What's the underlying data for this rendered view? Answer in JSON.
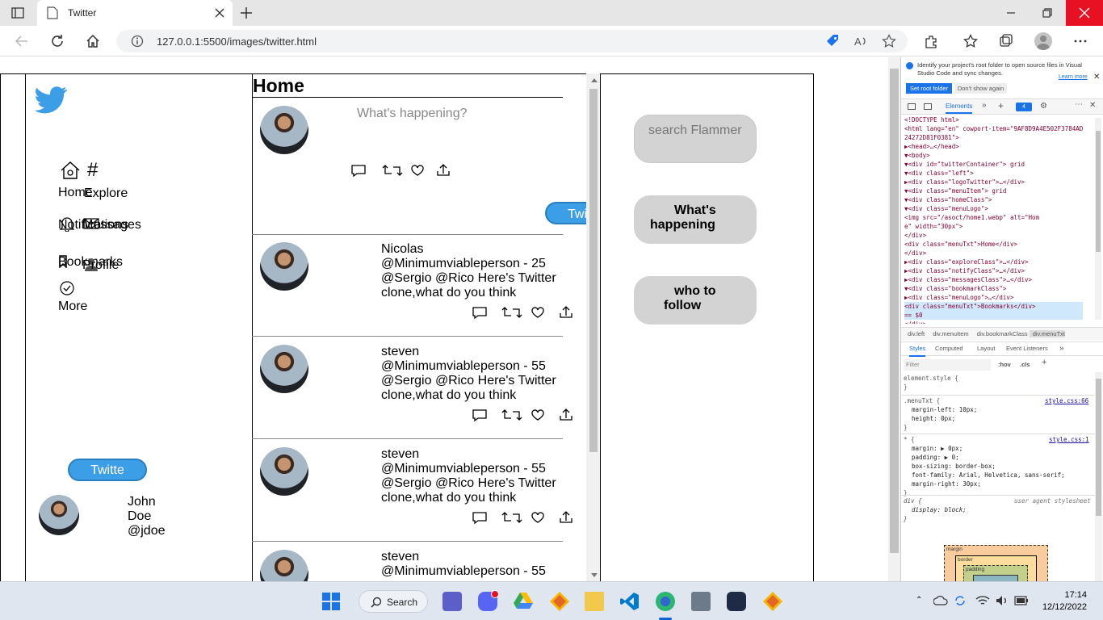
{
  "browser": {
    "tab_title": "Twitter",
    "url": "127.0.0.1:5500/images/twitter.html"
  },
  "sidebar": {
    "items": [
      {
        "label": "Home",
        "icon": "home-icon"
      },
      {
        "label": "Explore",
        "icon": "hashtag-icon"
      },
      {
        "label": "Notifications",
        "icon": "bell-icon"
      },
      {
        "label": "Messages",
        "icon": "mail-icon"
      },
      {
        "label": "Bookmarks",
        "icon": "bookmark-icon"
      },
      {
        "label": "Profile",
        "icon": "person-icon"
      },
      {
        "label": "More",
        "icon": "more-circle-icon"
      }
    ],
    "tweet_button": "Twitte",
    "user": {
      "name_line1": "John",
      "name_line2": "Doe",
      "handle": "@jdoe"
    }
  },
  "feed": {
    "title": "Home",
    "compose_placeholder": "What's happening?",
    "tweet_button": "Twi",
    "tweets": [
      {
        "name": "Nicolas",
        "line1": "@Minimumviableperson - 25",
        "line2": "@Sergio @Rico Here's Twitter",
        "line3": "clone,what do you think"
      },
      {
        "name": "steven",
        "line1": "@Minimumviableperson - 55",
        "line2": "@Sergio @Rico Here's Twitter",
        "line3": "clone,what do you think"
      },
      {
        "name": "steven",
        "line1": "@Minimumviableperson - 55",
        "line2": "@Sergio @Rico Here's Twitter",
        "line3": "clone,what do you think"
      },
      {
        "name": "steven",
        "line1": "@Minimumviableperson - 55",
        "line2": "",
        "line3": ""
      }
    ]
  },
  "right": {
    "search_placeholder": "search Flammer",
    "whats_happening_1": "What's",
    "whats_happening_2": "happening",
    "who_to_follow_1": "who to",
    "who_to_follow_2": "follow"
  },
  "devtools": {
    "notice": "Identify your project's root folder to open source files in Visual Studio Code and sync changes.",
    "learn_more": "Learn more",
    "set_root": "Set root folder",
    "dont_show": "Don't show again",
    "elements_tab": "Elements",
    "badge": "4",
    "code_lines": [
      "<!DOCTYPE html>",
      "<html lang=\"en\" cowport-item=\"9AF8D9A4E502F3784AD",
      "24272D81F0381\">",
      "▶<head>…</head>",
      "▼<body>",
      "  ▼<div id=\"twitterContainer\"> grid",
      "    ▼<div class=\"left\">",
      "      ▶<div class=\"logoTwitter\">…</div>",
      "      ▼<div class=\"menuItem\"> grid",
      "        ▼<div class=\"homeClass\">",
      "          ▼<div class=\"menuLogo\">",
      "              <img src=\"/asoct/home1.webp\" alt=\"Hom",
      "              e\" width=\"30px\">",
      "            </div>",
      "          <div class=\"menuTxt\">Home</div>",
      "        </div>",
      "      ▶<div class=\"exploreClass\">…</div>",
      "      ▶<div class=\"notifyClass\">…</div>",
      "      ▶<div class=\"messagesClass\">…</div>",
      "      ▼<div class=\"bookmarkClass\">",
      "        ▶<div class=\"menuLogo\">…</div>",
      "          <div class=\"menuTxt\">Bookmarks</div>",
      "          == $0",
      "        </div>"
    ],
    "breadcrumbs": [
      "div.left",
      "div.menuItem",
      "div.bookmarkClass",
      "div.menuTxt"
    ],
    "style_tabs": [
      "Styles",
      "Computed",
      "Layout",
      "Event Listeners"
    ],
    "filter_placeholder": "Filter",
    "hov": ":hov",
    "cls": ".cls",
    "styles": [
      {
        "selector": "element.style {",
        "source": "",
        "props": [
          "}"
        ]
      },
      {
        "selector": ".menuTxt {",
        "source": "style.css:66",
        "props": [
          "margin-left: 10px;",
          "height: 0px;",
          "}"
        ]
      },
      {
        "selector": "* {",
        "source": "style.css:1",
        "props": [
          "margin: ▶ 0px;",
          "padding: ▶ 0;",
          "box-sizing: border-box;",
          "font-family: Arial, Helvetica, sans-serif;",
          "margin-right: 30px;",
          "}"
        ]
      },
      {
        "selector": "div {",
        "source": "user agent stylesheet",
        "props": [
          "display: block;",
          "}"
        ]
      }
    ],
    "box_margin": "margin",
    "box_border": "border",
    "box_padding": "padding"
  },
  "taskbar": {
    "search": "Search",
    "time": "17:14",
    "date": "12/12/2022"
  }
}
